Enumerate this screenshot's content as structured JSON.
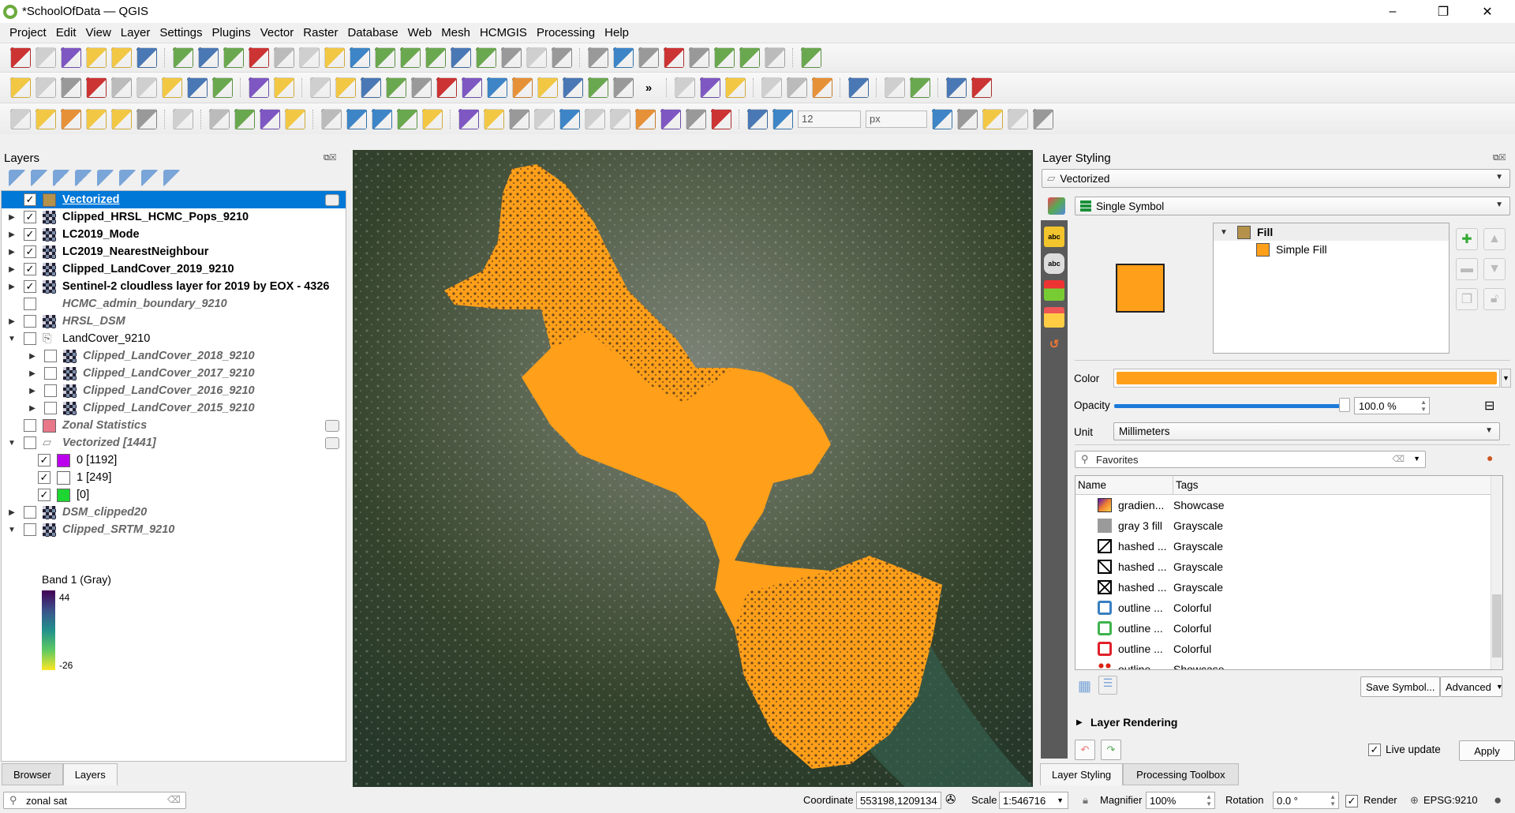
{
  "window": {
    "title": "*SchoolOfData — QGIS",
    "minimize": "–",
    "maximize": "❐",
    "close": "✕"
  },
  "menu": [
    "Project",
    "Edit",
    "View",
    "Layer",
    "Settings",
    "Plugins",
    "Vector",
    "Raster",
    "Database",
    "Web",
    "Mesh",
    "HCMGIS",
    "Processing",
    "Help"
  ],
  "toolbars": {
    "row1": [
      "new-project",
      "open-project",
      "save-project",
      "new-print-layout",
      "layout-manager",
      "style-manager",
      "|",
      "pan",
      "pan-to-selection",
      "zoom-in",
      "zoom-out",
      "zoom-full",
      "zoom-to-selection",
      "zoom-to-layer",
      "zoom-native",
      "zoom-last",
      "zoom-next",
      "new-map-view",
      "new-3d-map-view",
      "new-bookmark",
      "show-bookmarks",
      "temporal-controller",
      "refresh",
      "|",
      "identify",
      "open-attribute-table",
      "statistics-summary",
      "toggle-processing",
      "sum",
      "measure",
      "annotation-text",
      "map-tips",
      "|",
      "field-calculator"
    ],
    "row2": [
      "label",
      "diagram",
      "pin-label",
      "highlight-label",
      "label-a",
      "label-b",
      "label-c",
      "label-d",
      "label-e",
      "|",
      "georef",
      "triangle",
      "|",
      "digitize-1",
      "digitize-2",
      "digitize-3",
      "digitize-4",
      "digitize-5",
      "digitize-6",
      "digitize-7",
      "digitize-8",
      "digitize-9",
      "digitize-10",
      "digitize-11",
      "digitize-12",
      "digitize-13",
      "more",
      "|",
      "python",
      "hammer",
      "undo-plugin",
      "|",
      "globe",
      "info-green",
      "swipe",
      "|",
      "profile",
      "|",
      "topology",
      "table-refresh",
      "|",
      "search-green",
      "paint"
    ],
    "row3": [
      "data-source-manager",
      "new-geopackage",
      "new-shapefile",
      "new-temp",
      "new-virtual",
      "new-spatialite",
      "|",
      "help",
      "|",
      "select-feature",
      "select-by-value",
      "deselect",
      "select-by-location",
      "|",
      "add-point",
      "add-circle",
      "add-ring",
      "add-part",
      "add-polygon",
      "|",
      "edit-toggle",
      "pencil",
      "save-edits",
      "rollback",
      "vertex-tool",
      "delete",
      "cut",
      "copy",
      "paste",
      "undo",
      "redo",
      "|",
      "snapping",
      "trace"
    ],
    "snap_tolerance": "12",
    "snap_unit": "px",
    "row3b": [
      "advanced-digitize",
      "reshape",
      "split",
      "merge",
      "offset"
    ]
  },
  "layers_panel": {
    "title": "Layers",
    "tools": [
      "open-styling",
      "add-group",
      "manage-visibility",
      "filter-legend",
      "filter-expression",
      "expand-all",
      "collapse-all",
      "remove-layer"
    ],
    "items": [
      {
        "label": "Vectorized",
        "checked": true,
        "style": "b",
        "indent": 0,
        "exp": "",
        "icon": "swatch",
        "color": "#b5924c",
        "selected": true,
        "badge": true
      },
      {
        "label": "Clipped_HRSL_HCMC_Pops_9210",
        "checked": true,
        "style": "b",
        "indent": 0,
        "exp": "right",
        "icon": "raster"
      },
      {
        "label": "LC2019_Mode",
        "checked": true,
        "style": "b",
        "indent": 0,
        "exp": "right",
        "icon": "raster"
      },
      {
        "label": "LC2019_NearestNeighbour",
        "checked": true,
        "style": "b",
        "indent": 0,
        "exp": "right",
        "icon": "raster"
      },
      {
        "label": "Clipped_LandCover_2019_9210",
        "checked": true,
        "style": "b",
        "indent": 0,
        "exp": "right",
        "icon": "raster"
      },
      {
        "label": "Sentinel-2 cloudless layer for 2019 by EOX - 4326",
        "checked": true,
        "style": "b",
        "indent": 0,
        "exp": "right",
        "icon": "raster"
      },
      {
        "label": "HCMC_admin_boundary_9210",
        "checked": false,
        "style": "i",
        "indent": 0,
        "exp": "",
        "icon": "none"
      },
      {
        "label": "HRSL_DSM",
        "checked": false,
        "style": "i",
        "indent": 0,
        "exp": "right",
        "icon": "raster"
      },
      {
        "label": "LandCover_9210",
        "checked": false,
        "style": "n",
        "indent": 0,
        "exp": "down",
        "icon": "group"
      },
      {
        "label": "Clipped_LandCover_2018_9210",
        "checked": false,
        "style": "i",
        "indent": 1,
        "exp": "right",
        "icon": "raster"
      },
      {
        "label": "Clipped_LandCover_2017_9210",
        "checked": false,
        "style": "i",
        "indent": 1,
        "exp": "right",
        "icon": "raster"
      },
      {
        "label": "Clipped_LandCover_2016_9210",
        "checked": false,
        "style": "i",
        "indent": 1,
        "exp": "right",
        "icon": "raster"
      },
      {
        "label": "Clipped_LandCover_2015_9210",
        "checked": false,
        "style": "i",
        "indent": 1,
        "exp": "right",
        "icon": "raster"
      },
      {
        "label": "Zonal Statistics",
        "checked": false,
        "style": "i",
        "indent": 0,
        "exp": "",
        "icon": "swatch",
        "color": "#e8778a",
        "badge": true
      },
      {
        "label": "Vectorized [1441]",
        "checked": false,
        "style": "i",
        "indent": 0,
        "exp": "down",
        "icon": "polygon",
        "badge": true
      },
      {
        "label": "0 [1192]",
        "checked": true,
        "style": "n",
        "indent": 1,
        "exp": "",
        "icon": "swatch",
        "color": "#bb00ee",
        "legend": true
      },
      {
        "label": "1 [249]",
        "checked": true,
        "style": "n",
        "indent": 1,
        "exp": "",
        "icon": "swatch",
        "color": "#ffffff",
        "legend": true
      },
      {
        "label": " [0]",
        "checked": true,
        "style": "n",
        "indent": 1,
        "exp": "",
        "icon": "swatch",
        "color": "#1ed632",
        "legend": true
      },
      {
        "label": "DSM_clipped20",
        "checked": false,
        "style": "i",
        "indent": 0,
        "exp": "right",
        "icon": "raster"
      },
      {
        "label": "Clipped_SRTM_9210",
        "checked": false,
        "style": "i",
        "indent": 0,
        "exp": "down",
        "icon": "raster"
      }
    ],
    "legend": {
      "band": "Band 1 (Gray)",
      "max": "44",
      "min": "-26"
    },
    "tabs": [
      "Browser",
      "Layers"
    ],
    "active_tab": "Layers",
    "search_value": "zonal sat"
  },
  "styling": {
    "title": "Layer Styling",
    "layer": "Vectorized",
    "renderer": "Single Symbol",
    "tree": {
      "root": "Fill",
      "child": "Simple Fill",
      "root_color": "#b5924c"
    },
    "fill_color": "#ff9f1a",
    "color_label": "Color",
    "opacity_label": "Opacity",
    "opacity_value": "100.0 %",
    "opacity": 100,
    "unit_label": "Unit",
    "unit_value": "Millimeters",
    "search_placeholder": "Favorites",
    "columns": [
      "Name",
      "Tags"
    ],
    "symbols": [
      {
        "name": "gradien...",
        "tag": "Showcase",
        "icon": "gradient"
      },
      {
        "name": "gray 3 fill",
        "tag": "Grayscale",
        "icon": "gray"
      },
      {
        "name": "hashed ...",
        "tag": "Grayscale",
        "icon": "hash-fwd"
      },
      {
        "name": "hashed ...",
        "tag": "Grayscale",
        "icon": "hash-back"
      },
      {
        "name": "hashed ...",
        "tag": "Grayscale",
        "icon": "hash-cross"
      },
      {
        "name": "outline ...",
        "tag": "Colorful",
        "icon": "outline-blue"
      },
      {
        "name": "outline ...",
        "tag": "Colorful",
        "icon": "outline-green"
      },
      {
        "name": "outline ...",
        "tag": "Colorful",
        "icon": "outline-red"
      },
      {
        "name": "outline ...",
        "tag": "Showcase",
        "icon": "outline-dots"
      }
    ],
    "save_symbol": "Save Symbol...",
    "advanced": "Advanced",
    "layer_rendering": "Layer Rendering",
    "live_update": "Live update",
    "live_update_checked": true,
    "apply": "Apply",
    "tabs": [
      "Layer Styling",
      "Processing Toolbox"
    ],
    "active_tab": "Layer Styling"
  },
  "status": {
    "coordinate_label": "Coordinate",
    "coordinate": "553198,1209134",
    "scale_label": "Scale",
    "scale": "1:546716",
    "magnifier_label": "Magnifier",
    "magnifier": "100%",
    "rotation_label": "Rotation",
    "rotation": "0.0 °",
    "render_label": "Render",
    "render_checked": true,
    "crs": "EPSG:9210"
  },
  "colors": {
    "selection": "#0078d7",
    "vector_fill": "#ff9f1a"
  }
}
